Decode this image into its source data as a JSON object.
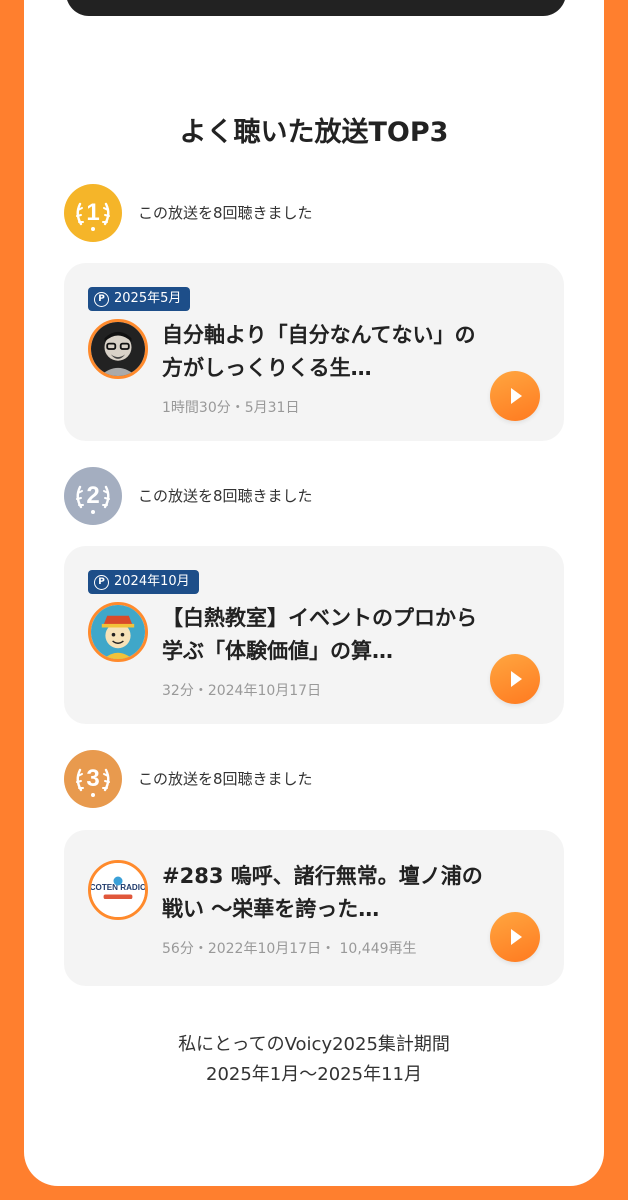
{
  "title": "よく聴いた放送TOP3",
  "ranking": [
    {
      "rank": "1",
      "listen_text": "この放送を8回聴きました",
      "medal_color": "#f5b529",
      "badge": "2025年5月",
      "badge_mark": "P",
      "title": "自分軸より「自分なんてない」の方がしっくりくる生…",
      "meta": "1時間30分・5月31日",
      "avatar_icon": "person-glasses-avatar-icon"
    },
    {
      "rank": "2",
      "listen_text": "この放送を8回聴きました",
      "medal_color": "#a4aec0",
      "badge": "2024年10月",
      "badge_mark": "P",
      "title": "【白熱教室】イベントのプロから学ぶ「体験価値」の算…",
      "meta": "32分・2024年10月17日",
      "avatar_icon": "illustrated-character-avatar-icon"
    },
    {
      "rank": "3",
      "listen_text": "この放送を8回聴きました",
      "medal_color": "#e89a4e",
      "title": "#283 嗚呼、諸行無常。壇ノ浦の戦い ～栄華を誇った…",
      "meta": "56分・2022年10月17日・ 10,449再生",
      "avatar_icon": "coten-radio-logo-icon",
      "avatar_logo": "COTEN RADIO"
    }
  ],
  "footer": {
    "line1": "私にとってのVoicy2025集計期間",
    "line2": "2025年1月～2025年11月"
  },
  "colors": {
    "background": "#ff7f2e",
    "badge": "#1d4e89",
    "play": "#ff8a2c"
  }
}
